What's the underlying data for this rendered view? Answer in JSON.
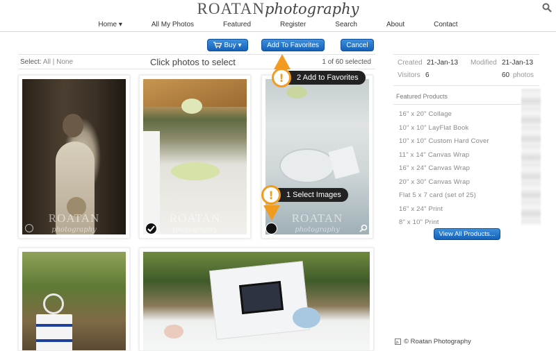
{
  "header": {
    "logo_main": "ROATAN",
    "logo_script": "photography",
    "nav": [
      "Home ▾",
      "All My Photos",
      "Featured",
      "Register",
      "Search",
      "About",
      "Contact"
    ]
  },
  "toolbar": {
    "buy_label": "Buy ▾",
    "favorites_label": "Add To Favorites",
    "cancel_label": "Cancel"
  },
  "selection": {
    "select_prefix": "Select:",
    "all": "All",
    "separator": "|",
    "none": "None",
    "hint": "Click photos to select",
    "count": "1 of 60 selected"
  },
  "callouts": {
    "step1": "1 Select Images",
    "step2": "2 Add to Favorites",
    "glyph": "!"
  },
  "photos": [
    {
      "watermark": "ROATAN",
      "watermark_script": "photography",
      "selected": false
    },
    {
      "watermark": "ROATAN",
      "watermark_script": "photography",
      "selected": true
    },
    {
      "watermark": "ROATAN",
      "watermark_script": "photography",
      "selected": false
    },
    {
      "watermark": "",
      "watermark_script": "",
      "selected": false
    },
    {
      "watermark": "",
      "watermark_script": "",
      "selected": false
    }
  ],
  "sidebar": {
    "created_label": "Created",
    "created": "21-Jan-13",
    "modified_label": "Modified",
    "modified": "21-Jan-13",
    "visitors_label": "Visitors",
    "visitors": "6",
    "photos_count": "60",
    "photos_label": "photos",
    "featured_title": "Featured Products",
    "products": [
      "16\" x 20\" Collage",
      "10\" x 10\" LayFlat Book",
      "10\" x 10\" Custom Hard Cover",
      "11\" x 14\" Canvas Wrap",
      "16\" x 24\" Canvas Wrap",
      "20\" x 30\" Canvas Wrap",
      "Flat 5 x 7 card (set of 25)",
      "16\" x 24\" Print",
      "8\" x 10\" Print"
    ],
    "view_all": "View All Products..."
  },
  "footer": {
    "text": "© Roatan Photography"
  },
  "colors": {
    "button": "#1a68c0",
    "callout_accent": "#f29b21",
    "callout_bg": "#222222"
  }
}
